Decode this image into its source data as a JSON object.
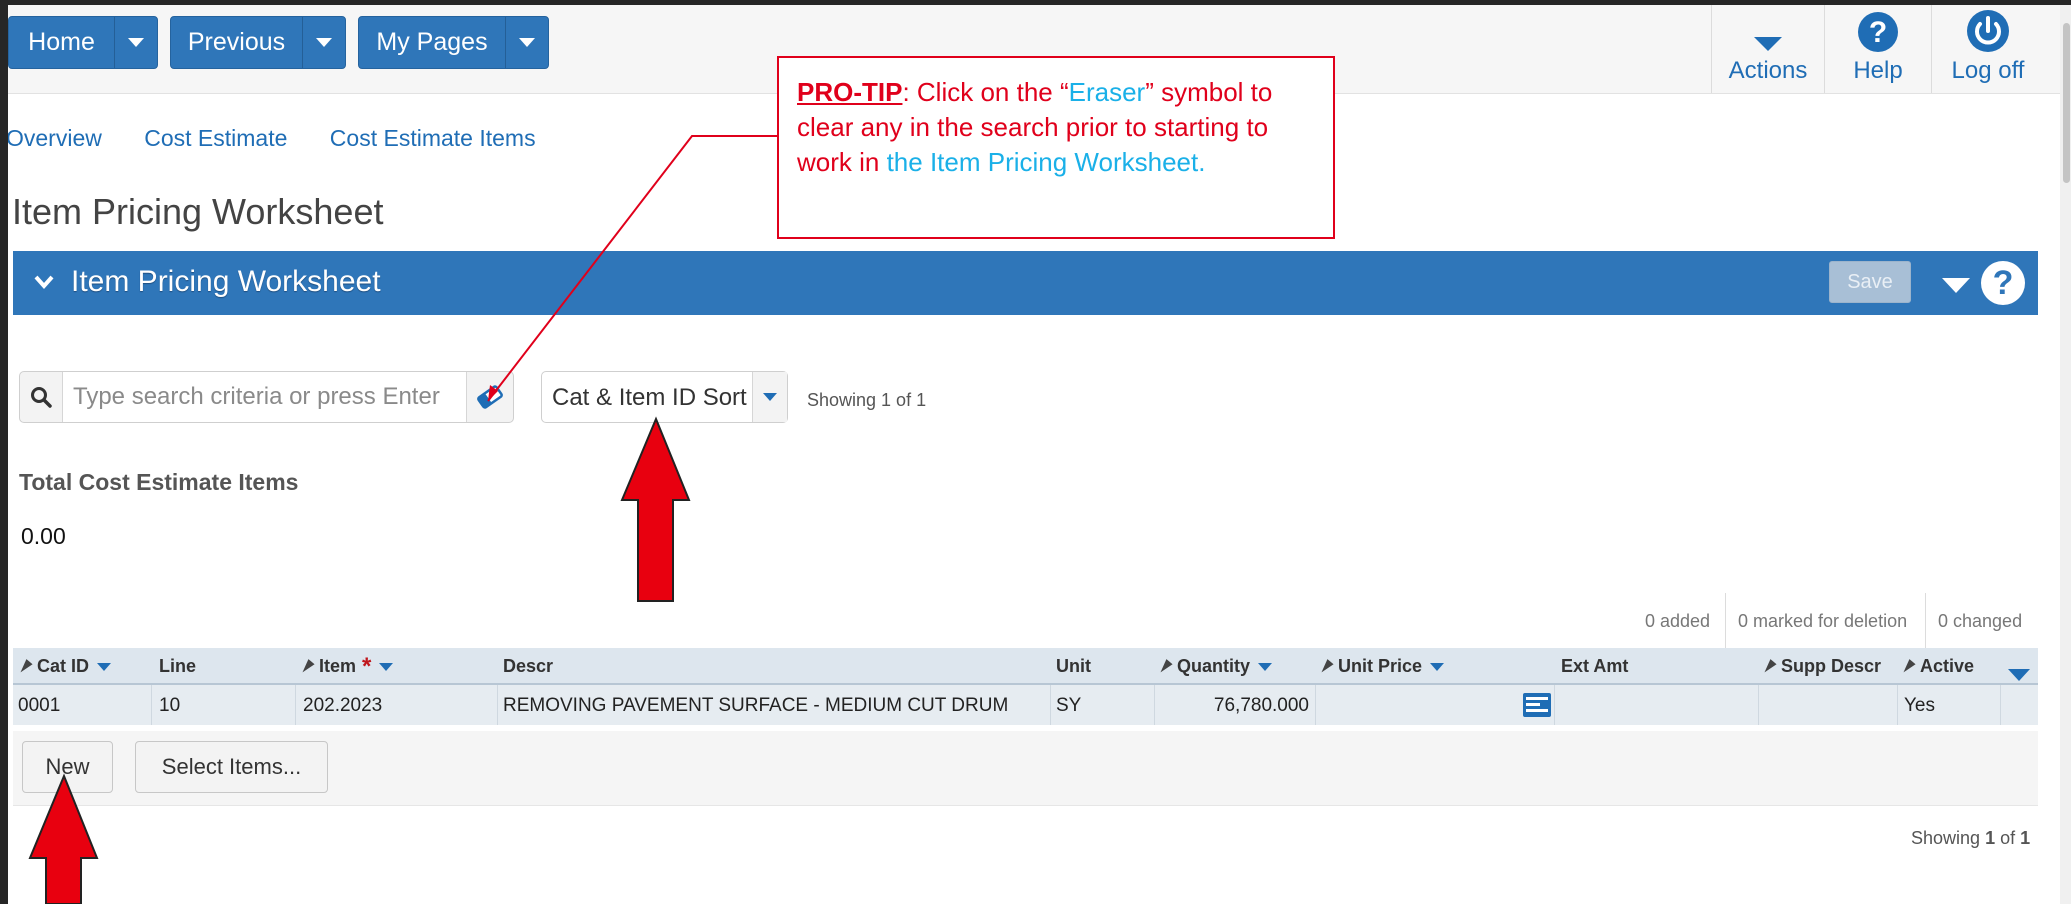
{
  "topnav": {
    "buttons": [
      {
        "label": "Home"
      },
      {
        "label": "Previous"
      },
      {
        "label": "My Pages"
      }
    ],
    "actions": [
      {
        "label": "Actions",
        "icon": "chevron-down-icon"
      },
      {
        "label": "Help",
        "icon": "question-circle-icon"
      },
      {
        "label": "Log off",
        "icon": "power-icon"
      }
    ]
  },
  "breadcrumbs": [
    "Overview",
    "Cost Estimate",
    "Cost Estimate Items"
  ],
  "page_title": "Item Pricing Worksheet",
  "panel": {
    "title": "Item Pricing Worksheet",
    "save_label": "Save",
    "help_icon": "?"
  },
  "search": {
    "placeholder": "Type search criteria or press Enter",
    "value": "",
    "sort_value": "Cat & Item ID Sort",
    "showing": "Showing 1 of 1"
  },
  "totals": {
    "label": "Total Cost Estimate Items",
    "value": "0.00"
  },
  "change_counts": {
    "added": "0 added",
    "deleted": "0 marked for deletion",
    "changed": "0 changed"
  },
  "grid": {
    "columns": [
      "Cat ID",
      "Line",
      "Item",
      "Descr",
      "Unit",
      "Quantity",
      "Unit Price",
      "Ext Amt",
      "Supp Descr",
      "Active"
    ],
    "rows": [
      {
        "cat_id": "0001",
        "line": "10",
        "item": "202.2023",
        "descr": "REMOVING PAVEMENT SURFACE - MEDIUM CUT DRUM",
        "unit": "SY",
        "quantity": "76,780.000",
        "unit_price": "",
        "ext_amt": "",
        "supp_descr": "",
        "active": "Yes"
      }
    ]
  },
  "footer": {
    "new_label": "New",
    "select_label": "Select Items...",
    "showing_prefix": "Showing",
    "showing_current": "1",
    "showing_of": "of",
    "showing_total": "1"
  },
  "pro_tip": {
    "heading": "PRO-TIP",
    "part1": ": Click on the “",
    "eraser": "Eraser",
    "part2": "” symbol to clear any in the search prior to starting to work in ",
    "worksheet": "the Item Pricing Worksheet."
  },
  "colors": {
    "brand_blue": "#2f76b9",
    "link_blue": "#1f6db5",
    "annotation_red": "#e0001b",
    "tip_blue": "#1ab0e8"
  }
}
